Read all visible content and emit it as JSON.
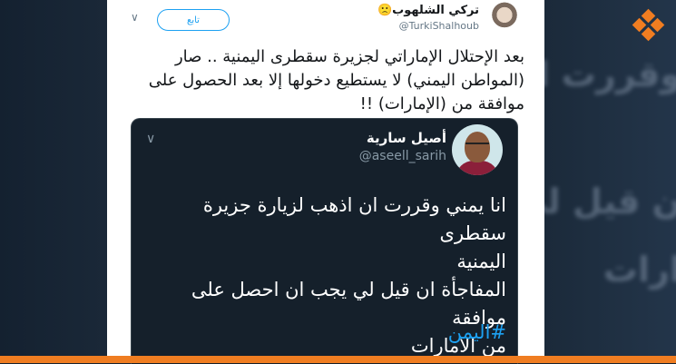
{
  "background": {
    "lines": [
      "وقررت ان",
      "ن قيل لي",
      "ارات"
    ]
  },
  "logo": {
    "icon": "brand-diamonds-icon",
    "color": "#f07d21"
  },
  "tweet": {
    "display_name": "تركي الشلهوب🙁",
    "handle": "@TurkiShalhoub",
    "follow_label": "تابع",
    "text": "بعد الإحتلال الإماراتي لجزيرة سقطرى اليمنية .. صار (المواطن اليمني) لا يستطيع دخولها إلا بعد الحصول على موافقة من (الإمارات) !!"
  },
  "quoted_tweet": {
    "display_name": "أصيل سارية",
    "handle": "@aseell_sarih",
    "text_lines": [
      "انا يمني وقررت ان اذهب لزيارة جزيرة سقطرى",
      "اليمنية",
      "المفاجأة ان قيل لي يجب ان احصل على موافقة",
      "من الامارات"
    ],
    "hashtag": "#اليمن"
  },
  "colors": {
    "accent": "#1da1f2",
    "brand": "#f07d21",
    "quote_bg": "#15202b"
  }
}
